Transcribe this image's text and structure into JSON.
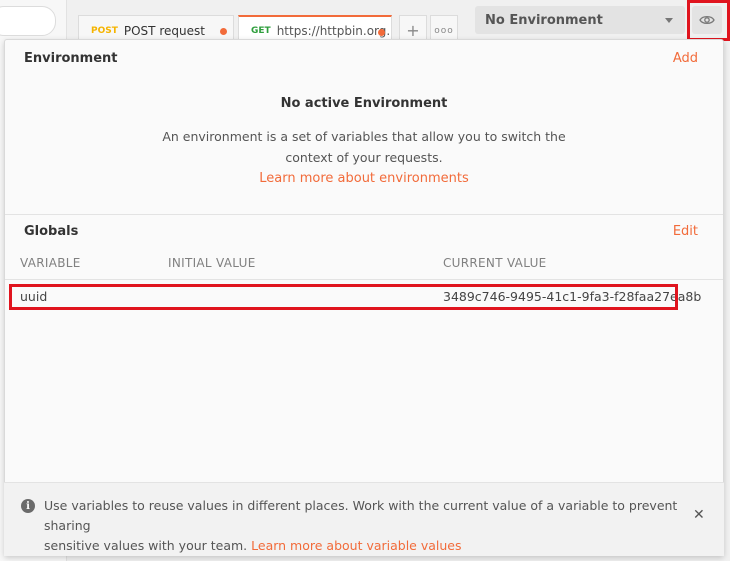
{
  "tabs": [
    {
      "method": "POST",
      "title": "POST request",
      "method_color": "#f5b400"
    },
    {
      "method": "GET",
      "title": "https://httpbin.org...",
      "method_color": "#2e9e3c"
    }
  ],
  "tab_actions": {
    "new_tab_icon": "plus-icon",
    "more_icon": "ellipsis-icon",
    "new_tab_symbol": "+",
    "more_symbol": "ooo"
  },
  "environment_selector": {
    "value": "No Environment",
    "icon": "chevron-down-icon"
  },
  "eye_button": {
    "icon": "eye-icon"
  },
  "popup": {
    "environment": {
      "title": "Environment",
      "add_label": "Add",
      "empty_heading": "No active Environment",
      "empty_text_line1": "An environment is a set of variables that allow you to switch the",
      "empty_text_line2": "context of your requests.",
      "learn_link": "Learn more about environments"
    },
    "globals": {
      "title": "Globals",
      "edit_label": "Edit",
      "columns": [
        "VARIABLE",
        "INITIAL VALUE",
        "CURRENT VALUE"
      ],
      "rows": [
        {
          "variable": "uuid",
          "initial_value": "",
          "current_value": "3489c746-9495-41c1-9fa3-f28faa27ea8b"
        }
      ]
    },
    "footer": {
      "icon": "info-icon",
      "info_symbol": "i",
      "text_line1": "Use variables to reuse values in different places. Work with the current value of a variable to prevent sharing",
      "text_line2": "sensitive values with your team.",
      "link": "Learn more about variable values",
      "close_symbol": "✕"
    }
  },
  "colors": {
    "accent": "#f26b3a",
    "highlight": "#e0141e"
  }
}
